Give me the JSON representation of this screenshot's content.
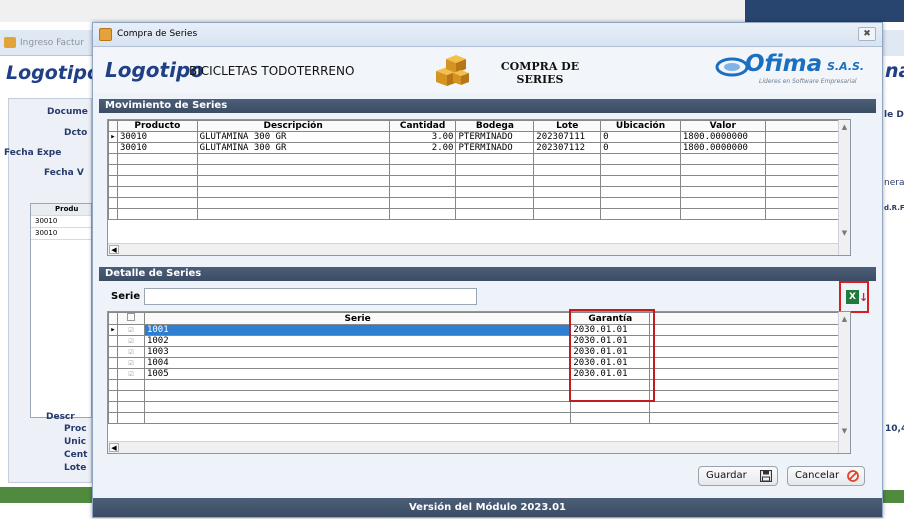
{
  "background": {
    "window_title": "Ingreso Factur",
    "logo": "Logotipo",
    "labels": [
      "Docume",
      "Dcto",
      "Fecha Expe",
      "Fecha V",
      "Produ",
      "Descr",
      "Proc",
      "Unic",
      "Cent",
      "Lote"
    ],
    "grid_rows": [
      "30010",
      "30010"
    ],
    "right_logo": "na",
    "right_labels": [
      "le D",
      "nera",
      "d.R.Fl",
      "10,4"
    ]
  },
  "dialog": {
    "title": "Compra de Series",
    "close_label": "✖"
  },
  "header": {
    "logo": "Logotipo",
    "company": "BICICLETAS TODOTERRENO",
    "title_line1": "COMPRA DE",
    "title_line2": "SERIES",
    "brand": "Ofima",
    "brand_suffix": "S.A.S.",
    "brand_tagline": "Líderes en Software Empresarial"
  },
  "movimiento": {
    "section_title": "Movimiento de Series",
    "columns": [
      "Producto",
      "Descripción",
      "Cantidad",
      "Bodega",
      "Lote",
      "Ubicación",
      "Valor"
    ],
    "rows": [
      {
        "producto": "30010",
        "descripcion": "GLUTAMINA 300 GR",
        "cantidad": "3.00",
        "bodega": "PTERMINADO",
        "lote": "202307111",
        "ubicacion": "0",
        "valor": "1800.0000000"
      },
      {
        "producto": "30010",
        "descripcion": "GLUTAMINA 300 GR",
        "cantidad": "2.00",
        "bodega": "PTERMINADO",
        "lote": "202307112",
        "ubicacion": "0",
        "valor": "1800.0000000"
      }
    ]
  },
  "detalle": {
    "section_title": "Detalle de Series",
    "serie_label": "Serie",
    "serie_value": "",
    "columns": [
      "Serie",
      "Garantía"
    ],
    "rows": [
      {
        "serie": "1001",
        "garantia": "2030.01.01",
        "checked": true
      },
      {
        "serie": "1002",
        "garantia": "2030.01.01",
        "checked": true
      },
      {
        "serie": "1003",
        "garantia": "2030.01.01",
        "checked": true
      },
      {
        "serie": "1004",
        "garantia": "2030.01.01",
        "checked": true
      },
      {
        "serie": "1005",
        "garantia": "2030.01.01",
        "checked": true
      }
    ]
  },
  "buttons": {
    "guardar": "Guardar",
    "cancelar": "Cancelar"
  },
  "footer": "Versión del Módulo 2023.01",
  "colors": {
    "section_header": "#3b4c64",
    "selected_row": "#2c7fd1",
    "highlight_box": "#c21c1c",
    "brand_blue": "#1a6fc0"
  }
}
